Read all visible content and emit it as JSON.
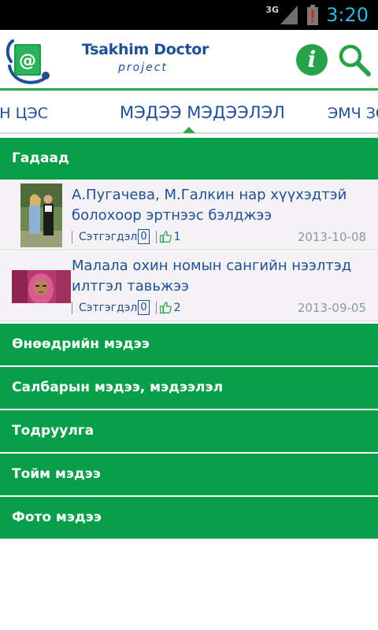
{
  "status_bar": {
    "network": "3G",
    "time": "3:20"
  },
  "header": {
    "brand_title": "Tsakhim Doctor",
    "brand_subtitle": "project",
    "info_label": "i"
  },
  "tabs": [
    {
      "label": "ЭН ЦЭС"
    },
    {
      "label": "МЭДЭЭ МЭДЭЭЛЭЛ"
    },
    {
      "label": "ЭМЧ ЗӨ"
    }
  ],
  "categories": [
    {
      "label": "Гадаад"
    },
    {
      "label": "Өнөөдрийн мэдээ"
    },
    {
      "label": "Салбарын мэдээ, мэдээлэл"
    },
    {
      "label": "Тодруулга"
    },
    {
      "label": "Тойм мэдээ"
    },
    {
      "label": "Фото мэдээ"
    }
  ],
  "news": [
    {
      "title": "А.Пугачева, М.Галкин нар хүүхэдтэй болохоор эртнээс бэлджээ",
      "comments_label": "Сэтгэгдэл",
      "comments": "0",
      "likes": "1",
      "date": "2013-10-08"
    },
    {
      "title": "Малала охин номын сангийн нээлтэд илтгэл тавьжээ",
      "comments_label": "Сэтгэгдэл",
      "comments": "0",
      "likes": "2",
      "date": "2013-09-05"
    }
  ],
  "colors": {
    "accent_green": "#089e4a",
    "brand_blue": "#1f4f95",
    "status_time": "#33b5e5"
  }
}
